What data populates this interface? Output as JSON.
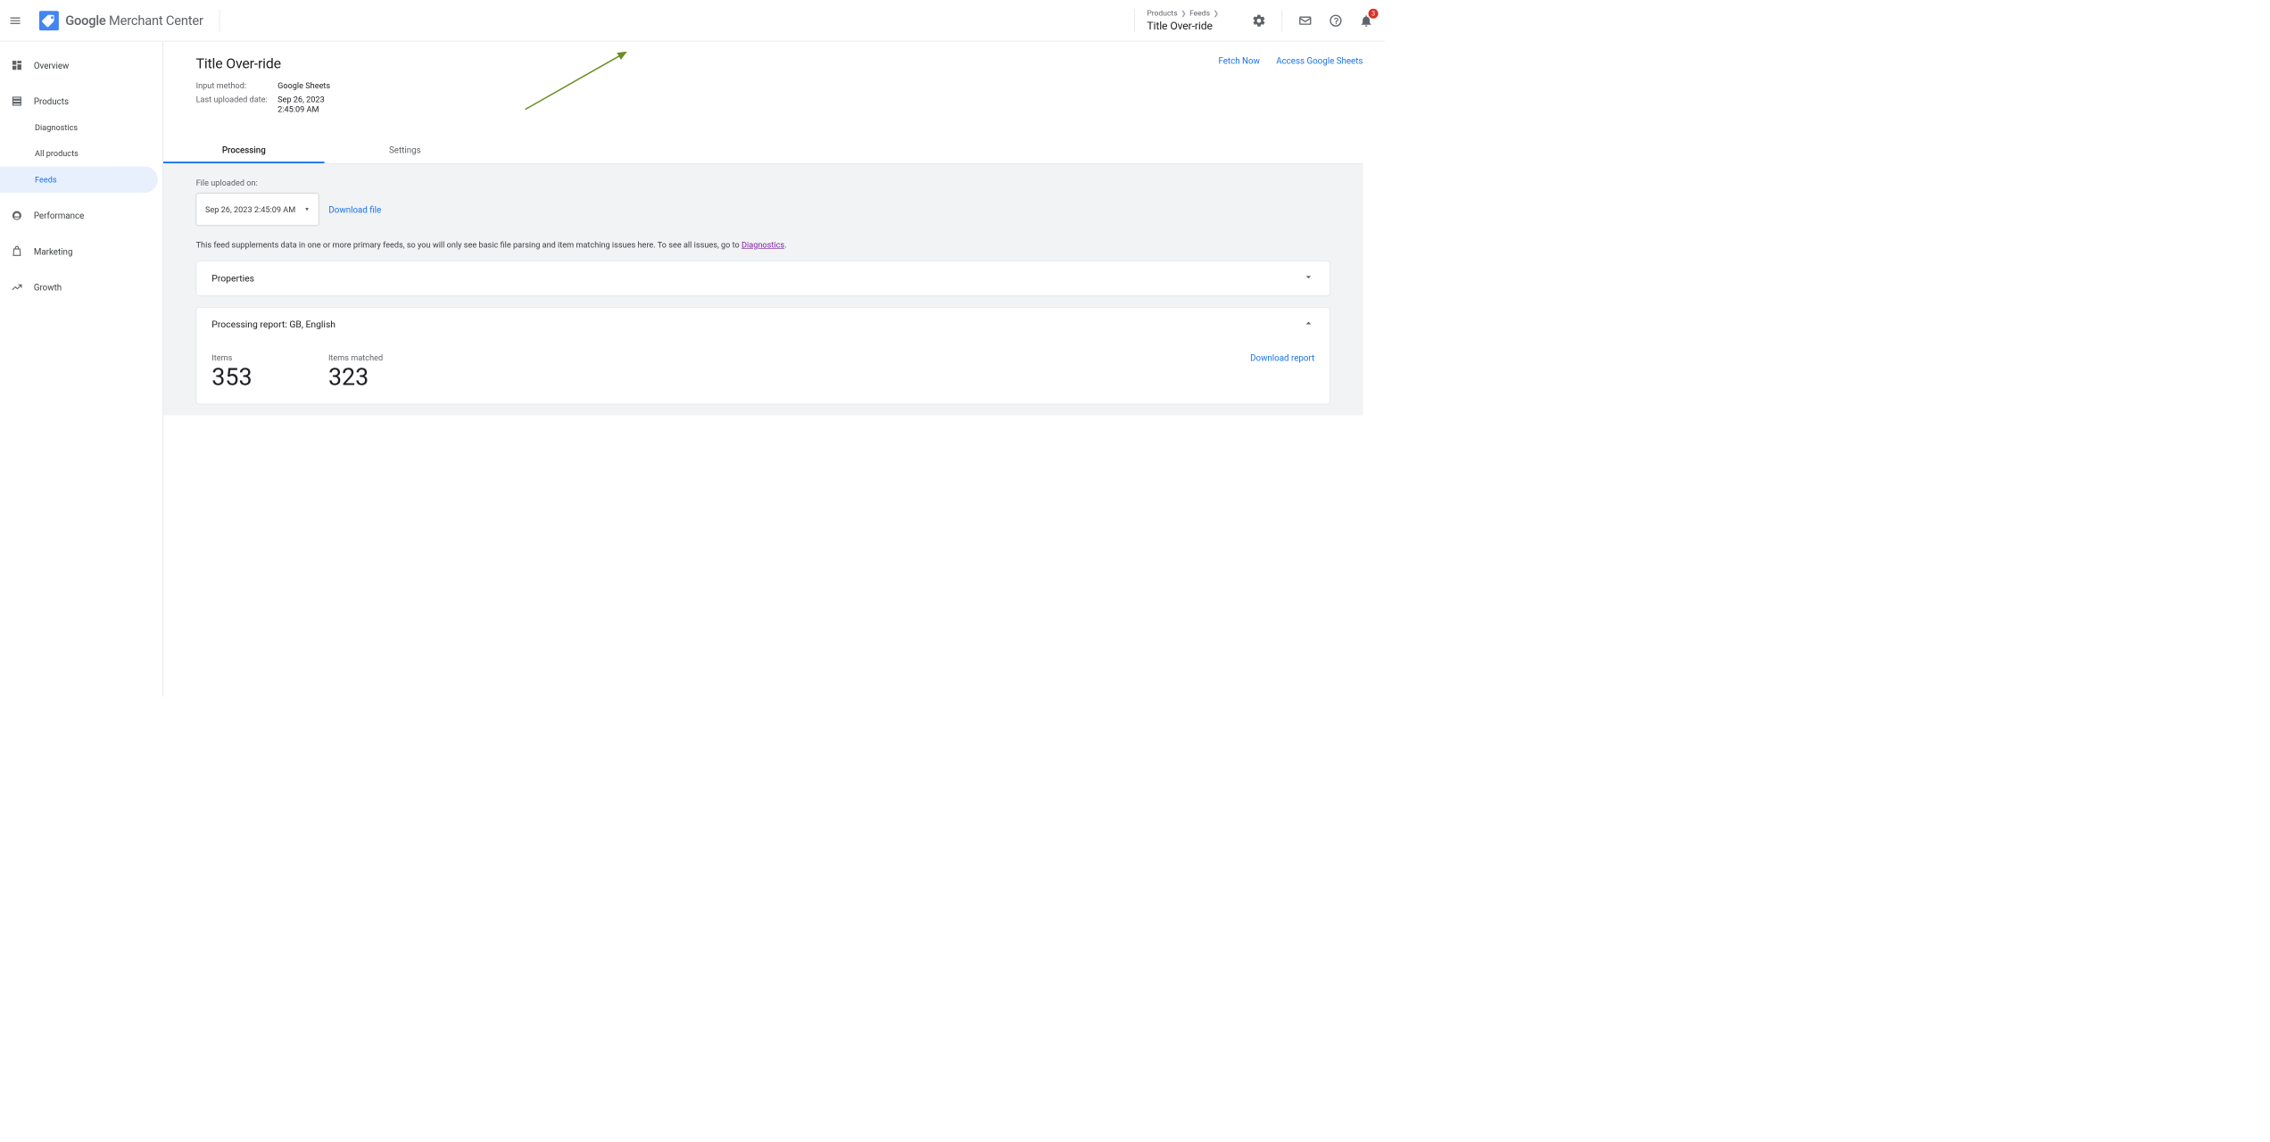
{
  "header": {
    "app_name_strong": "Google",
    "app_name_rest": " Merchant Center",
    "breadcrumb": [
      "Products",
      "Feeds"
    ],
    "breadcrumb_title": "Title Over-ride",
    "notification_count": "3"
  },
  "sidebar": {
    "overview": "Overview",
    "products": "Products",
    "diagnostics": "Diagnostics",
    "all_products": "All products",
    "feeds": "Feeds",
    "performance": "Performance",
    "marketing": "Marketing",
    "growth": "Growth"
  },
  "main": {
    "title": "Title Over-ride",
    "actions": {
      "fetch_now": "Fetch Now",
      "access_sheets": "Access Google Sheets"
    },
    "meta": {
      "input_method_label": "Input method:",
      "input_method_value": "Google Sheets",
      "uploaded_label": "Last uploaded date:",
      "uploaded_value_line1": "Sep 26, 2023",
      "uploaded_value_line2": "2:45:09 AM"
    },
    "tabs": {
      "processing": "Processing",
      "settings": "Settings"
    },
    "processing": {
      "file_uploaded_label": "File uploaded on:",
      "picker_value": "Sep 26, 2023 2:45:09 AM",
      "download_file": "Download file",
      "note_prefix": "This feed supplements data in one or more primary feeds, so you will only see basic file parsing and item matching issues here. To see all issues, go to ",
      "note_link": "Diagnostics",
      "properties_title": "Properties",
      "report_title": "Processing report: GB, English",
      "download_report": "Download report",
      "metrics": {
        "items_label": "Items",
        "items_value": "353",
        "matched_label": "Items matched",
        "matched_value": "323"
      }
    }
  }
}
